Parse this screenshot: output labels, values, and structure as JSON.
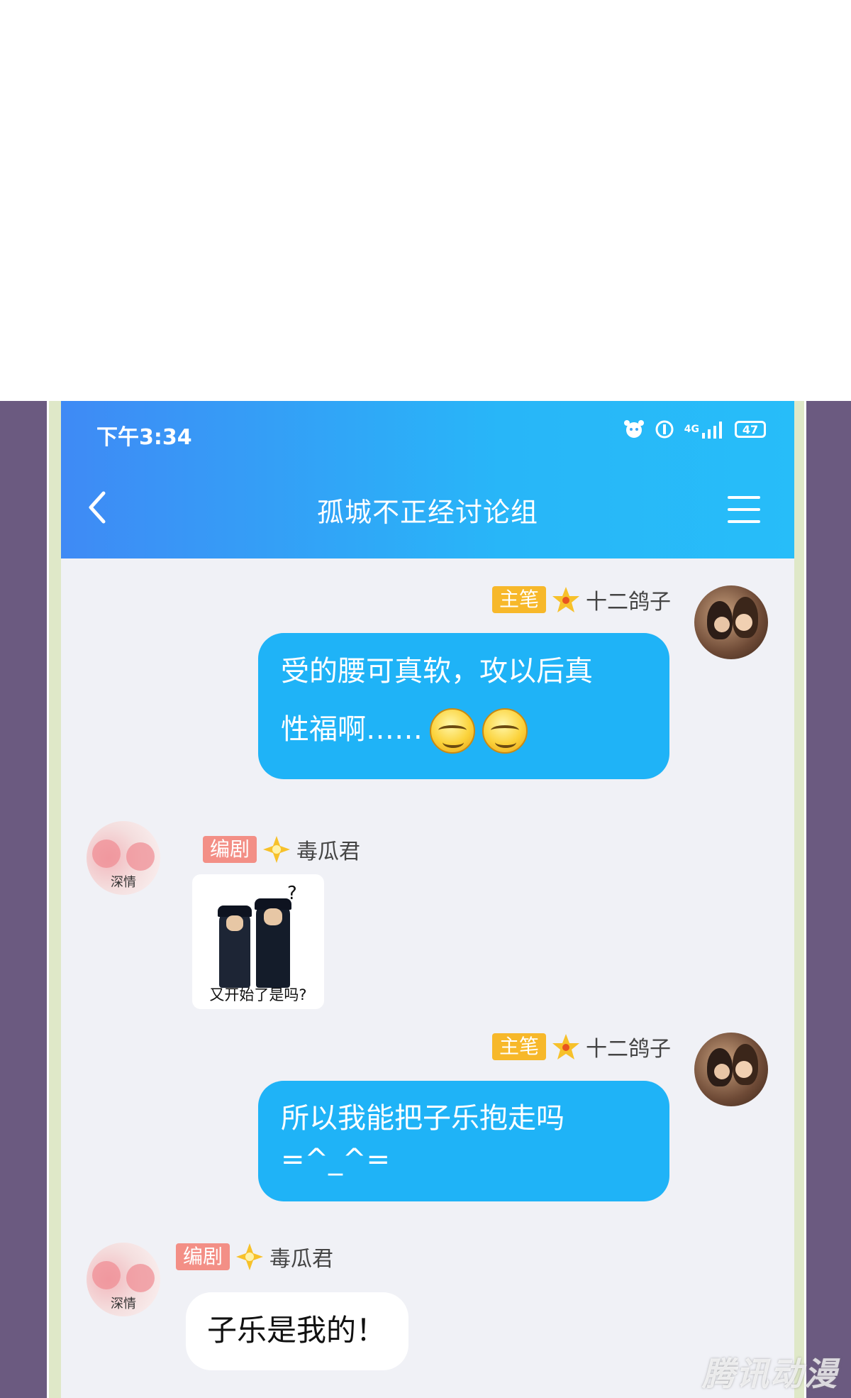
{
  "status_bar": {
    "time": "下午3:34",
    "network": "4G",
    "battery": "47"
  },
  "header": {
    "title": "孤城不正经讨论组"
  },
  "messages": [
    {
      "badge": "主笔",
      "sender": "十二鸽子",
      "text_line1": "受的腰可真软，攻以后真",
      "text_line2": "性福啊……"
    },
    {
      "badge": "编剧",
      "sender": "毒瓜君",
      "avatar_caption": "深情",
      "sticker_caption": "又开始了是吗?",
      "sticker_q": "?"
    },
    {
      "badge": "主笔",
      "sender": "十二鸽子",
      "text_line1": "所以我能把子乐抱走吗",
      "text_line2": "=^_^="
    },
    {
      "badge": "编剧",
      "sender": "毒瓜君",
      "avatar_caption": "深情",
      "text": "子乐是我的！"
    }
  ],
  "watermark": "腾讯动漫",
  "colors": {
    "header_start": "#3f8af5",
    "header_end": "#27bdf9",
    "bubble_blue": "#1fb3f7",
    "badge_gold": "#f7b82a",
    "badge_red": "#f38f86",
    "frame": "#6b5a80"
  }
}
